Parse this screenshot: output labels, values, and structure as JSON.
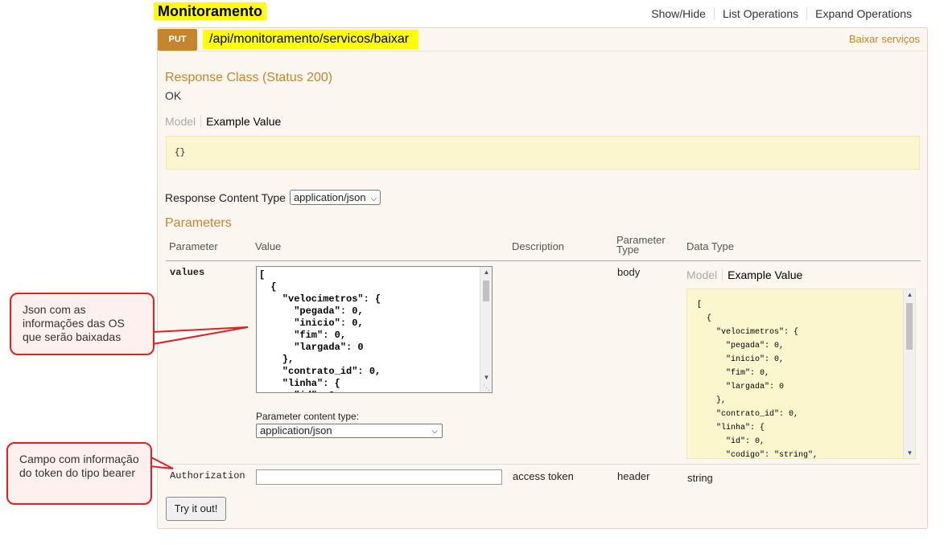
{
  "resource": {
    "title": "Monitoramento",
    "links": [
      "Show/Hide",
      "List Operations",
      "Expand Operations"
    ]
  },
  "operation": {
    "method": "PUT",
    "path": "/api/monitoramento/servicos/baixar",
    "summary": "Baixar serviços"
  },
  "response": {
    "heading": "Response Class (Status 200)",
    "status_text": "OK",
    "tab_model": "Model",
    "tab_example": "Example Value",
    "example": "{}",
    "content_type_label": "Response Content Type",
    "content_type_value": "application/json"
  },
  "parameters": {
    "heading": "Parameters",
    "columns": {
      "parameter": "Parameter",
      "value": "Value",
      "description": "Description",
      "parameter_type": "Parameter Type",
      "data_type": "Data Type"
    },
    "values_param": {
      "name": "values",
      "value": "[\n  {\n    \"velocimetros\": {\n      \"pegada\": 0,\n      \"inicio\": 0,\n      \"fim\": 0,\n      \"largada\": 0\n    },\n    \"contrato_id\": 0,\n    \"linha\": {\n      \"id\": 0,",
      "param_type": "body",
      "content_type_label": "Parameter content type:",
      "content_type_value": "application/json",
      "tab_model": "Model",
      "tab_example": "Example Value",
      "example": "[\n  {\n    \"velocimetros\": {\n      \"pegada\": 0,\n      \"inicio\": 0,\n      \"fim\": 0,\n      \"largada\": 0\n    },\n    \"contrato_id\": 0,\n    \"linha\": {\n      \"id\": 0,\n      \"codigo\": \"string\","
    },
    "auth_param": {
      "name": "Authorization",
      "value": "",
      "description": "access token",
      "param_type": "header",
      "data_type": "string"
    }
  },
  "try_button": "Try it out!",
  "callouts": {
    "json_note": "Json com as informações das OS que serão baixadas",
    "token_note": "Campo com informação do token do tipo bearer"
  },
  "colors": {
    "put": "#c5862b",
    "highlight": "#ffff00",
    "callout_border": "#e02020"
  }
}
